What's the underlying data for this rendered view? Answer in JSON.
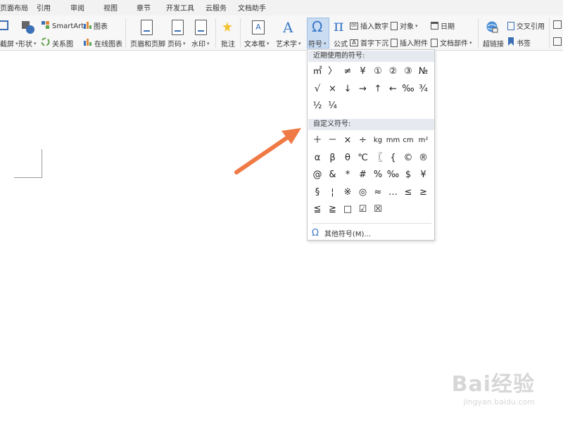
{
  "menubar": {
    "items": [
      "页面布局",
      "引用",
      "审阅",
      "视图",
      "章节",
      "开发工具",
      "云服务",
      "文档助手"
    ]
  },
  "ribbon": {
    "screenshot": "截屏",
    "shape": "形状",
    "smartart": "SmartArt",
    "chart": "图表",
    "relation": "关系图",
    "online_chart": "在线图表",
    "header_footer": "页眉和页脚",
    "page_number": "页码",
    "watermark": "水印",
    "comment": "批注",
    "textbox": "文本框",
    "wordart": "艺术字",
    "symbol": "符号",
    "formula": "公式",
    "insert_number": "插入数字",
    "object": "对象",
    "date": "日期",
    "dropcap": "首字下沉",
    "attachment": "插入附件",
    "doc_parts": "文档部件",
    "hyperlink": "超链接",
    "cross_ref": "交叉引用",
    "bookmark": "书签"
  },
  "dropdown": {
    "recent_title": "近期使用的符号:",
    "recent_symbols": [
      "㎡",
      "〉",
      "≠",
      "¥",
      "①",
      "②",
      "③",
      "№",
      "√",
      "×",
      "↓",
      "→",
      "↑",
      "←",
      "‰",
      "¾",
      "½",
      "¼"
    ],
    "custom_title": "自定义符号:",
    "custom_symbols": [
      "＋",
      "－",
      "×",
      "÷",
      "kg",
      "mm",
      "cm",
      "m²",
      "α",
      "β",
      "θ",
      "℃",
      "〖",
      "{",
      "©",
      "®",
      "@",
      "&",
      "*",
      "#",
      "%",
      "‰",
      "$",
      "¥",
      "§",
      "¦",
      "※",
      "◎",
      "≈",
      "…",
      "≤",
      "≥",
      "≦",
      "≧",
      "□",
      "☑",
      "☒"
    ],
    "more_label": "其他符号(M)..."
  },
  "colors": {
    "accent": "#3b78c8",
    "arrow": "#f07a45",
    "active_bg": "#c9dcf2"
  },
  "watermark": {
    "brand": "Bai经验",
    "url": "jingyan.baidu.com"
  }
}
